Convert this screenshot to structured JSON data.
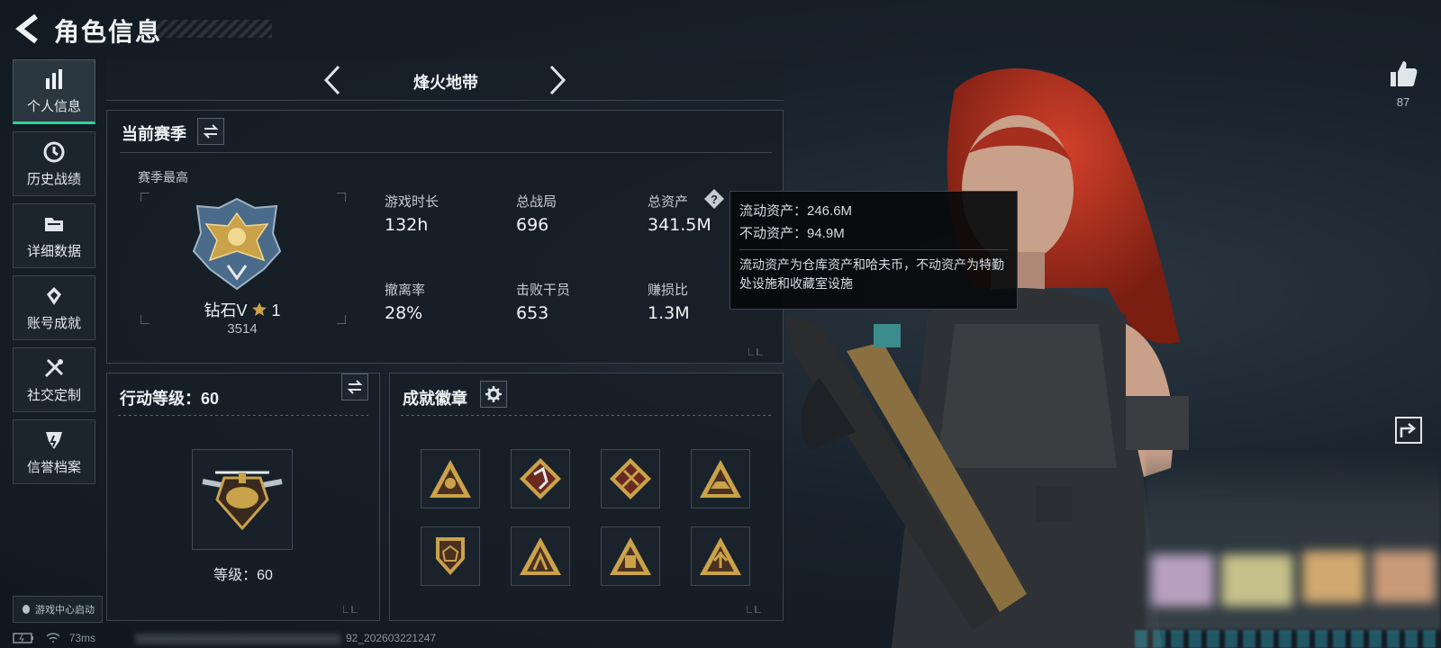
{
  "header": {
    "title": "角色信息"
  },
  "sidebar": {
    "items": [
      {
        "label": "个人信息",
        "icon": "bar-chart-icon",
        "active": true
      },
      {
        "label": "历史战绩",
        "icon": "history-icon",
        "active": false
      },
      {
        "label": "详细数据",
        "icon": "folder-icon",
        "active": false
      },
      {
        "label": "账号成就",
        "icon": "achievement-icon",
        "active": false
      },
      {
        "label": "社交定制",
        "icon": "tools-icon",
        "active": false
      },
      {
        "label": "信誉档案",
        "icon": "credit-icon",
        "active": false
      }
    ],
    "game_center": "游戏中心启动"
  },
  "mode": {
    "title": "烽火地带"
  },
  "season": {
    "title": "当前赛季",
    "best_label": "赛季最高",
    "rank_name": "钻石V",
    "rank_stars": "1",
    "rank_score": "3514",
    "stats": [
      {
        "label": "游戏时长",
        "value": "132h"
      },
      {
        "label": "总战局",
        "value": "696"
      },
      {
        "label": "总资产",
        "value": "341.5M"
      },
      {
        "label": "撤离率",
        "value": "28%"
      },
      {
        "label": "击败干员",
        "value": "653"
      },
      {
        "label": "赚损比",
        "value": "1.3M"
      }
    ]
  },
  "tooltip": {
    "liquid": "流动资产：246.6M",
    "fixed": "不动资产：94.9M",
    "description": "流动资产为仓库资产和哈夫币，不动资产为特勤处设施和收藏室设施"
  },
  "action_level": {
    "title": "行动等级：60",
    "level_text": "等级：60"
  },
  "badges": {
    "title": "成就徽章",
    "items": [
      "badge-1-icon",
      "badge-2-icon",
      "badge-3-icon",
      "badge-4-icon",
      "badge-5-icon",
      "badge-6-icon",
      "badge-7-icon",
      "badge-8-icon"
    ]
  },
  "social": {
    "like_count": "87"
  },
  "status": {
    "ping": "73ms",
    "build_suffix": "92_20260322124​7"
  },
  "colors": {
    "accent_green": "#2fd39a",
    "gold": "#c9a24a",
    "panel_border": "#3a4650"
  }
}
